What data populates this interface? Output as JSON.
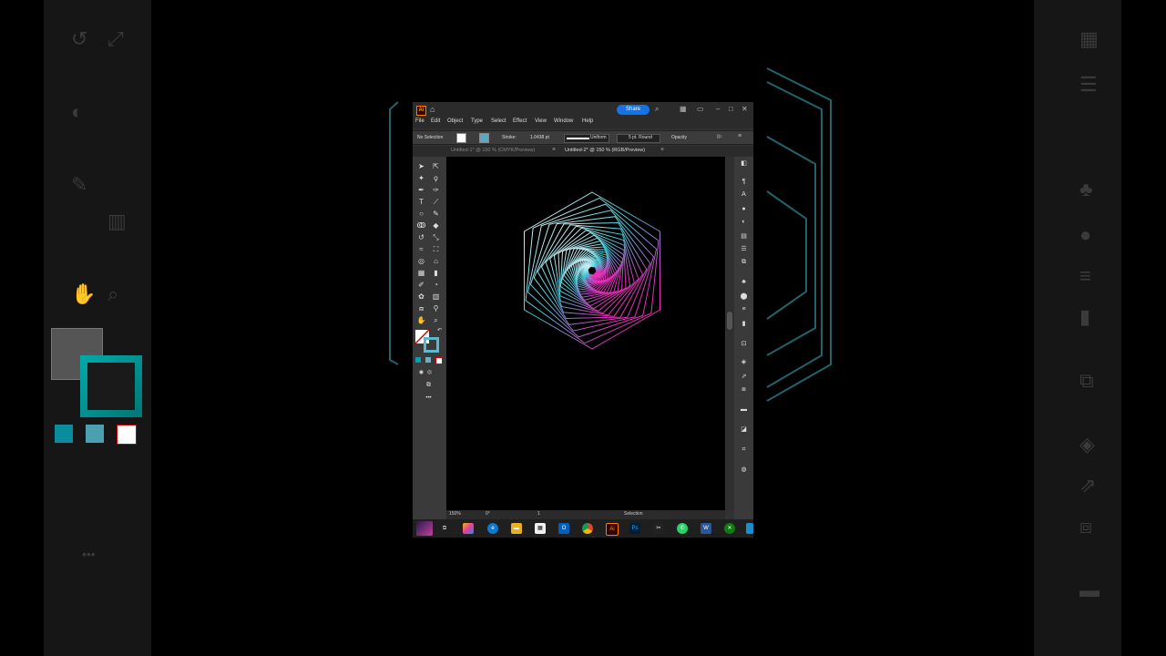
{
  "app": {
    "title_logo": "Ai"
  },
  "titlebar": {
    "share_label": "Share"
  },
  "menu": [
    "File",
    "Edit",
    "Object",
    "Type",
    "Select",
    "Effect",
    "View",
    "Window",
    "Help"
  ],
  "control_bar": {
    "selection": "No Selection",
    "stroke_label": "Stroke:",
    "stroke_value": "1.0438 pt",
    "profile": "Uniform",
    "brush": "5 pt. Round",
    "opacity_label": "Opacity"
  },
  "tabs": [
    {
      "label": "Untitled-1* @ 150 % (CMYK/Preview)",
      "active": false
    },
    {
      "label": "Untitled-2* @ 150 % (RGB/Preview)",
      "active": true
    }
  ],
  "status": {
    "zoom": "150%",
    "rotation": "0°",
    "artboard": "1",
    "mode": "Selection"
  },
  "colors": {
    "accent": "#1473e6",
    "cyan": "#00b8d4",
    "magenta": "#e020b0",
    "panel": "#323232"
  },
  "icons": [
    "selection-tool",
    "direct-selection-tool",
    "magic-wand",
    "lasso",
    "pen",
    "curvature",
    "type",
    "line",
    "rectangle",
    "paintbrush",
    "pencil",
    "eraser",
    "rotate",
    "scale",
    "width",
    "free-transform",
    "shape-builder",
    "live-paint",
    "perspective",
    "mesh",
    "gradient",
    "eyedropper",
    "blend",
    "symbol-sprayer",
    "column-graph",
    "artboard",
    "slice",
    "hand",
    "zoom"
  ]
}
